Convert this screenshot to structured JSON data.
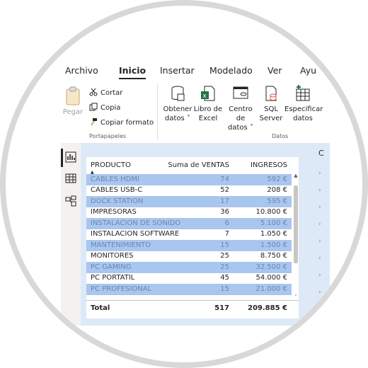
{
  "ribbon": {
    "tabs": [
      "Archivo",
      "Inicio",
      "Insertar",
      "Modelado",
      "Ver",
      "Ayu"
    ],
    "active_tab": "Inicio",
    "clipboard": {
      "paste": "Pegar",
      "cut": "Cortar",
      "copy": "Copia",
      "format_painter": "Copiar formato",
      "group_label": "Portapapeles"
    },
    "data": {
      "get_data": [
        "Obtener",
        "datos"
      ],
      "excel": [
        "Libro de",
        "Excel"
      ],
      "data_hub": [
        "Centro de",
        "datos"
      ],
      "sql": [
        "SQL",
        "Server"
      ],
      "enter_data": [
        "Especificar",
        "datos"
      ],
      "group_label": "Datos"
    }
  },
  "table": {
    "headers": {
      "product": "PRODUCTO",
      "sum": "Suma de VENTAS",
      "income": "INGRESOS"
    },
    "rows": [
      {
        "product": "CABLES HDMI",
        "sales": "74",
        "income": "592 €",
        "highlighted": true
      },
      {
        "product": "CABLES USB-C",
        "sales": "52",
        "income": "208 €",
        "highlighted": false
      },
      {
        "product": "DOCK STATION",
        "sales": "17",
        "income": "595 €",
        "highlighted": true
      },
      {
        "product": "IMPRESORAS",
        "sales": "36",
        "income": "10.800 €",
        "highlighted": false
      },
      {
        "product": "INSTALACION DE SONIDO",
        "sales": "6",
        "income": "5.100 €",
        "highlighted": true
      },
      {
        "product": "INSTALACION SOFTWARE",
        "sales": "7",
        "income": "1.050 €",
        "highlighted": false
      },
      {
        "product": "MANTENIMIENTO",
        "sales": "15",
        "income": "1.500 €",
        "highlighted": true
      },
      {
        "product": "MONITORES",
        "sales": "25",
        "income": "8.750 €",
        "highlighted": false
      },
      {
        "product": "PC GAMING",
        "sales": "25",
        "income": "32.500 €",
        "highlighted": true
      },
      {
        "product": "PC PORTATIL",
        "sales": "45",
        "income": "54.000 €",
        "highlighted": false
      },
      {
        "product": "PC PROFESIONAL",
        "sales": "15",
        "income": "21.000 €",
        "highlighted": true
      }
    ],
    "total": {
      "label": "Total",
      "sales": "517",
      "income": "209.885 €"
    }
  },
  "right_pane_partial": "C",
  "colors": {
    "highlight": "#a9c6ef",
    "canvas": "#dde9f7",
    "accent": "#252423"
  }
}
